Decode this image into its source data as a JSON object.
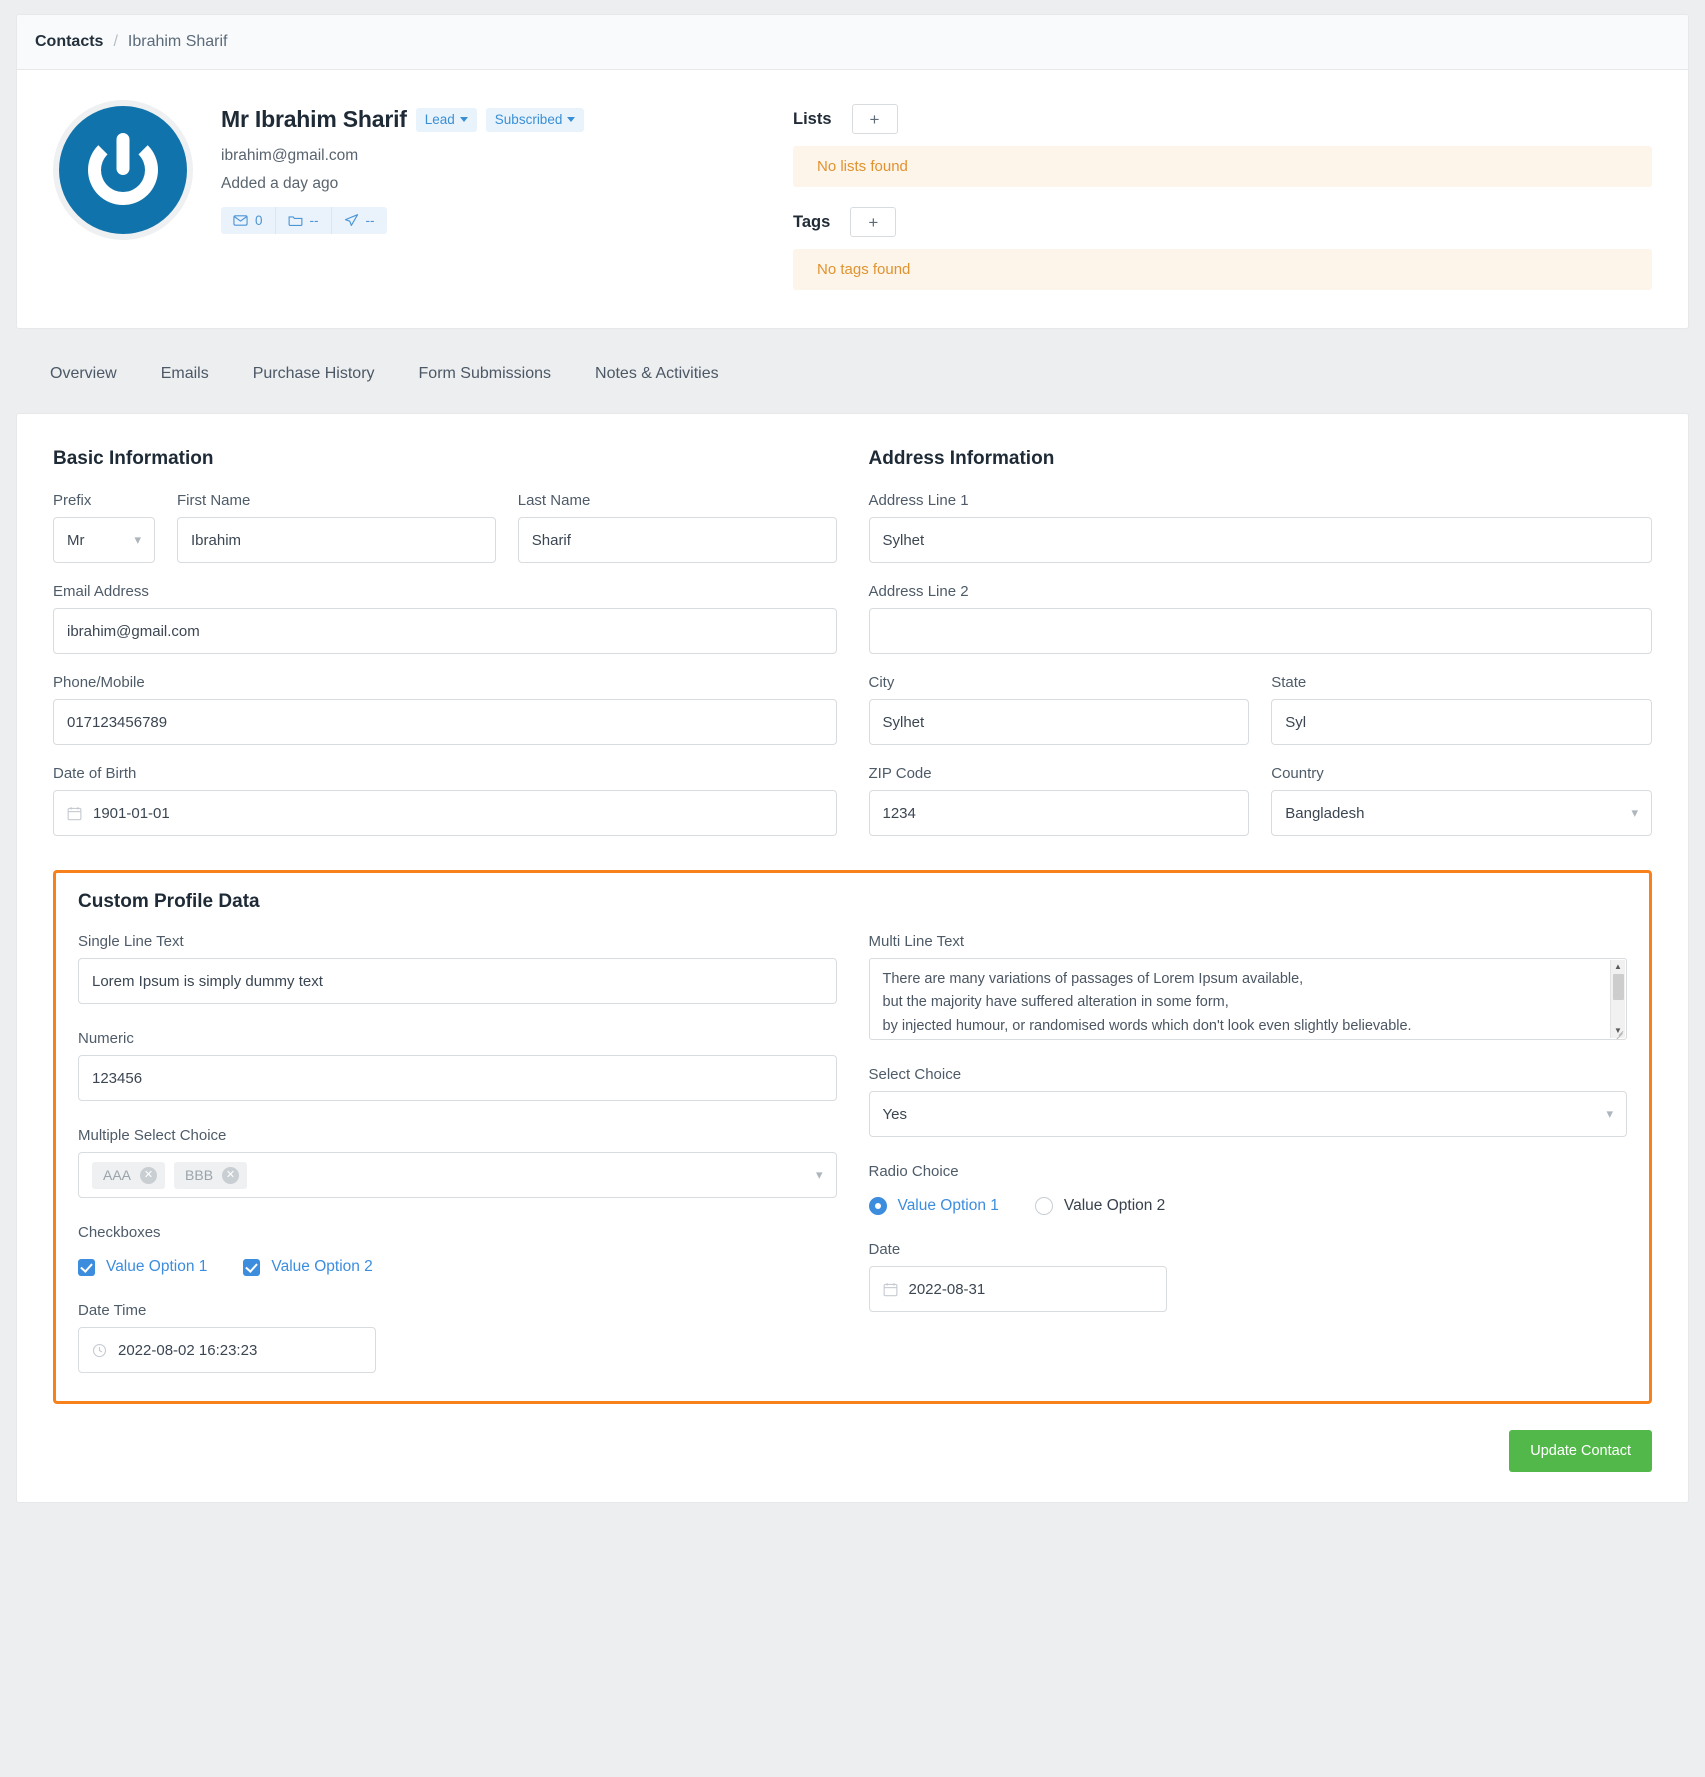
{
  "breadcrumb": {
    "root": "Contacts",
    "separator": "/",
    "current": "Ibrahim Sharif"
  },
  "profile": {
    "name": "Mr Ibrahim Sharif",
    "status_badge": "Lead",
    "subscription_badge": "Subscribed",
    "email": "ibrahim@gmail.com",
    "added": "Added a day ago",
    "stats": [
      {
        "icon": "envelope-icon",
        "value": "0"
      },
      {
        "icon": "folder-icon",
        "value": "--"
      },
      {
        "icon": "send-icon",
        "value": "--"
      }
    ]
  },
  "lists_panel": {
    "title": "Lists",
    "add_label": "+",
    "empty": "No lists found"
  },
  "tags_panel": {
    "title": "Tags",
    "add_label": "+",
    "empty": "No tags found"
  },
  "tabs": [
    {
      "label": "Overview",
      "active": true
    },
    {
      "label": "Emails",
      "active": false
    },
    {
      "label": "Purchase History",
      "active": false
    },
    {
      "label": "Form Submissions",
      "active": false
    },
    {
      "label": "Notes & Activities",
      "active": false
    }
  ],
  "basic": {
    "title": "Basic Information",
    "prefix_label": "Prefix",
    "prefix_value": "Mr",
    "first_label": "First Name",
    "first_value": "Ibrahim",
    "last_label": "Last Name",
    "last_value": "Sharif",
    "email_label": "Email Address",
    "email_value": "ibrahim@gmail.com",
    "phone_label": "Phone/Mobile",
    "phone_value": "017123456789",
    "dob_label": "Date of Birth",
    "dob_value": "1901-01-01"
  },
  "address": {
    "title": "Address Information",
    "line1_label": "Address Line 1",
    "line1_value": "Sylhet",
    "line2_label": "Address Line 2",
    "line2_value": "",
    "city_label": "City",
    "city_value": "Sylhet",
    "state_label": "State",
    "state_value": "Syl",
    "zip_label": "ZIP Code",
    "zip_value": "1234",
    "country_label": "Country",
    "country_value": "Bangladesh"
  },
  "custom": {
    "title": "Custom Profile Data",
    "single_line_label": "Single Line Text",
    "single_line_value": "Lorem Ipsum is simply dummy text",
    "multi_line_label": "Multi Line Text",
    "multi_line_value": "There are many variations of passages of Lorem Ipsum available,\nbut the majority have suffered alteration in some form,\n by injected humour, or randomised words which don't look even slightly believable.",
    "numeric_label": "Numeric",
    "numeric_value": "123456",
    "select_choice_label": "Select Choice",
    "select_choice_value": "Yes",
    "multi_select_label": "Multiple Select Choice",
    "multi_select_chips": [
      "AAA",
      "BBB"
    ],
    "radio_label": "Radio Choice",
    "radio_options": [
      {
        "label": "Value Option 1",
        "selected": true
      },
      {
        "label": "Value Option 2",
        "selected": false
      }
    ],
    "checkbox_label": "Checkboxes",
    "checkbox_options": [
      {
        "label": "Value Option 1",
        "checked": true
      },
      {
        "label": "Value Option 2",
        "checked": true
      }
    ],
    "date_label": "Date",
    "date_value": "2022-08-31",
    "datetime_label": "Date Time",
    "datetime_value": "2022-08-02 16:23:23"
  },
  "footer": {
    "update_label": "Update Contact"
  },
  "colors": {
    "accent_orange": "#f7821b",
    "link_blue": "#3c8dde",
    "success_green": "#53b84a",
    "warning_bg": "#fdf4ea"
  }
}
